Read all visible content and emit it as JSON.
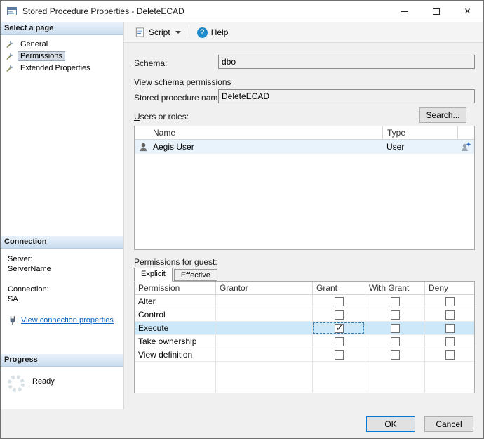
{
  "window": {
    "title": "Stored Procedure Properties - DeleteECAD"
  },
  "sidebar": {
    "select_page_header": "Select a page",
    "pages": [
      {
        "label": "General"
      },
      {
        "label": "Permissions"
      },
      {
        "label": "Extended Properties"
      }
    ],
    "connection": {
      "header": "Connection",
      "server_label": "Server:",
      "server_value": "ServerName",
      "connection_label": "Connection:",
      "connection_value": "SA",
      "link": "View connection properties"
    },
    "progress": {
      "header": "Progress",
      "status": "Ready"
    }
  },
  "toolbar": {
    "script": "Script",
    "help": "Help"
  },
  "form": {
    "schema_label": "Schema:",
    "schema_value": "dbo",
    "schema_link": "View schema permissions",
    "name_label": "Stored procedure name:",
    "name_value": "DeleteECAD",
    "users_label": "Users or roles:",
    "search_button": "Search...",
    "users_table": {
      "col_name": "Name",
      "col_type": "Type",
      "rows": [
        {
          "name": "Aegis User",
          "type": "User"
        }
      ]
    },
    "permissions_label": "Permissions for guest:",
    "tabs": [
      {
        "label": "Explicit"
      },
      {
        "label": "Effective"
      }
    ],
    "permissions_table": {
      "columns": [
        "Permission",
        "Grantor",
        "Grant",
        "With Grant",
        "Deny"
      ],
      "rows": [
        {
          "permission": "Alter",
          "grantor": "",
          "grant": false,
          "with_grant": false,
          "deny": false
        },
        {
          "permission": "Control",
          "grantor": "",
          "grant": false,
          "with_grant": false,
          "deny": false
        },
        {
          "permission": "Execute",
          "grantor": "",
          "grant": true,
          "with_grant": false,
          "deny": false
        },
        {
          "permission": "Take ownership",
          "grantor": "",
          "grant": false,
          "with_grant": false,
          "deny": false
        },
        {
          "permission": "View definition",
          "grantor": "",
          "grant": false,
          "with_grant": false,
          "deny": false
        }
      ]
    }
  },
  "footer": {
    "ok": "OK",
    "cancel": "Cancel"
  },
  "colors": {
    "accent": "#0078d7",
    "link": "#0563c1",
    "row_highlight": "#cde9f9",
    "header_gradient": "#c9dcee"
  }
}
